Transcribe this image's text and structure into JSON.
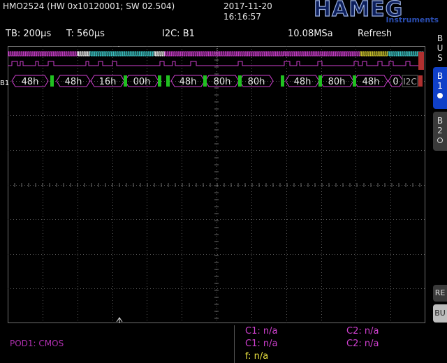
{
  "header": {
    "model": "HMO2524 (HW 0x10120001; SW 02.504)",
    "date": "2017-11-20",
    "time": "16:16:57",
    "logo_brand": "HAMEG",
    "logo_sub": "Instruments"
  },
  "topbar": {
    "timebase": "TB: 200µs",
    "trigger_time": "T: 560µs",
    "bus_label": "I2C: B1",
    "sample_rate": "10.08MSa",
    "mode": "Refresh"
  },
  "decode": {
    "bus_marker": "B1",
    "frames": [
      "48h",
      "48h",
      "16h",
      "00h",
      "48h",
      "80h",
      "80h",
      "48h",
      "80h",
      "48h",
      "0"
    ],
    "overflow_label": "I2C"
  },
  "sidebar": {
    "bus_letters": [
      "B",
      "U",
      "S"
    ],
    "b1_letters": [
      "B",
      "1"
    ],
    "b2_letters": [
      "B",
      "2"
    ],
    "re_label": "RE",
    "bu_label": "BU"
  },
  "measurements": {
    "c1_a": "C1: n/a",
    "c2_a": "C2: n/a",
    "c1_b": "C1: n/a",
    "c2_b": "C2: n/a",
    "f": "f: n/a",
    "pod": "POD1: CMOS"
  },
  "colors": {
    "grid": "#5a5a5a",
    "sda": "#d040d0",
    "scl_a": "#ffffff",
    "scl_b": "#40d0d0",
    "ack": "#20c020",
    "frame": "#d040d0",
    "accent": "#1040c8"
  }
}
